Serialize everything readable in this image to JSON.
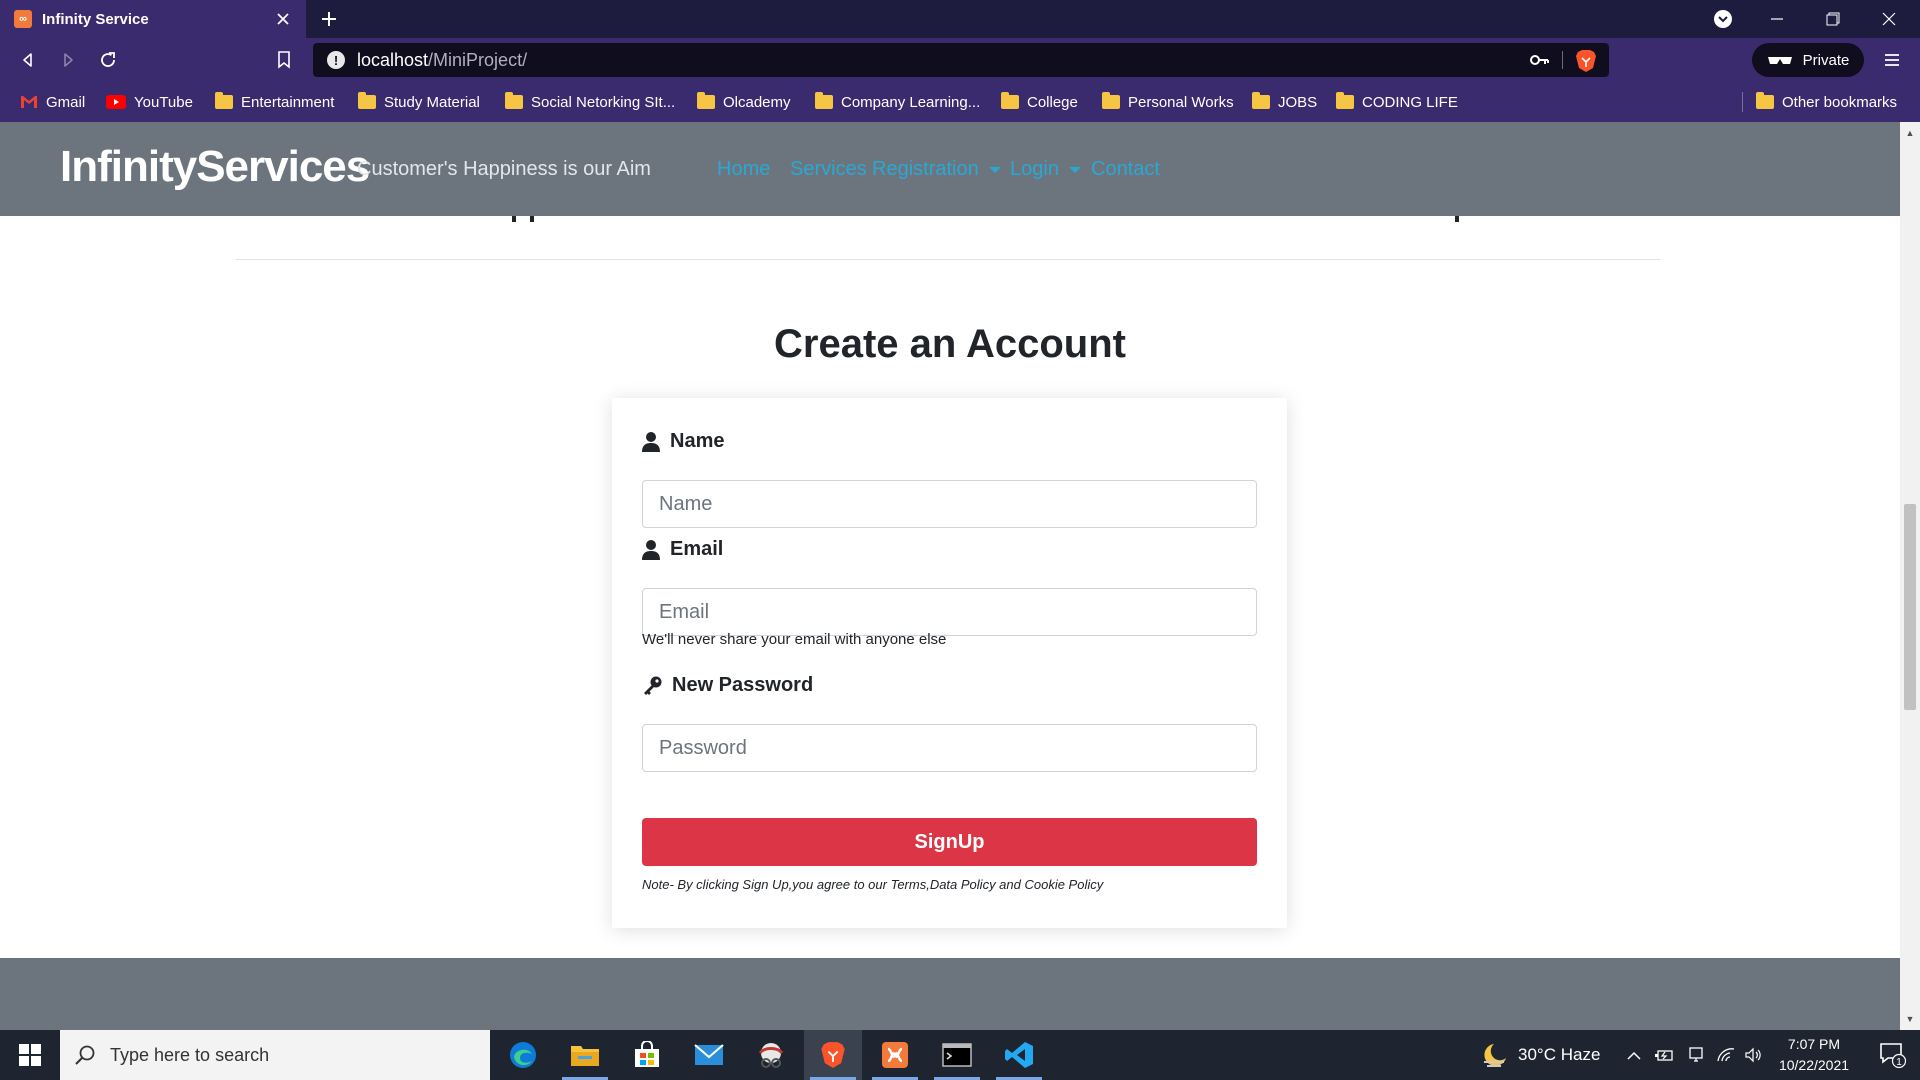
{
  "browser": {
    "tab_title": "Infinity Service",
    "url_host": "localhost",
    "url_path": "/MiniProject/",
    "private_label": "Private"
  },
  "bookmarks": [
    "Gmail",
    "YouTube",
    "Entertainment",
    "Study Material",
    "Social Netorking SIt...",
    "Olcademy",
    "Company Learning...",
    "College",
    "Personal Works",
    "JOBS",
    "CODING LIFE"
  ],
  "other_bookmarks": "Other bookmarks",
  "site": {
    "brand": "InfinityServices",
    "tagline": "Customer's Happiness is our Aim",
    "nav": {
      "home": "Home",
      "services": "Services",
      "registration": "Registration",
      "login": "Login",
      "contact": "Contact"
    }
  },
  "form": {
    "title": "Create an Account",
    "name_label": "Name",
    "name_placeholder": "Name",
    "email_label": "Email",
    "email_placeholder": "Email",
    "email_help": "We'll never share your email with anyone else",
    "password_label": "New Password",
    "password_placeholder": "Password",
    "submit_label": "SignUp",
    "note": "Note- By clicking Sign Up,you agree to our Terms,Data Policy and Cookie Policy"
  },
  "taskbar": {
    "search_placeholder": "Type here to search",
    "weather": "30°C  Haze",
    "time": "7:07 PM",
    "date": "10/22/2021",
    "notification_count": "1"
  },
  "colors": {
    "navbar_bg": "#6c757d",
    "nav_link": "#2aa8d4",
    "signup_button": "#dc3545",
    "browser_chrome": "#3a2a6e"
  }
}
